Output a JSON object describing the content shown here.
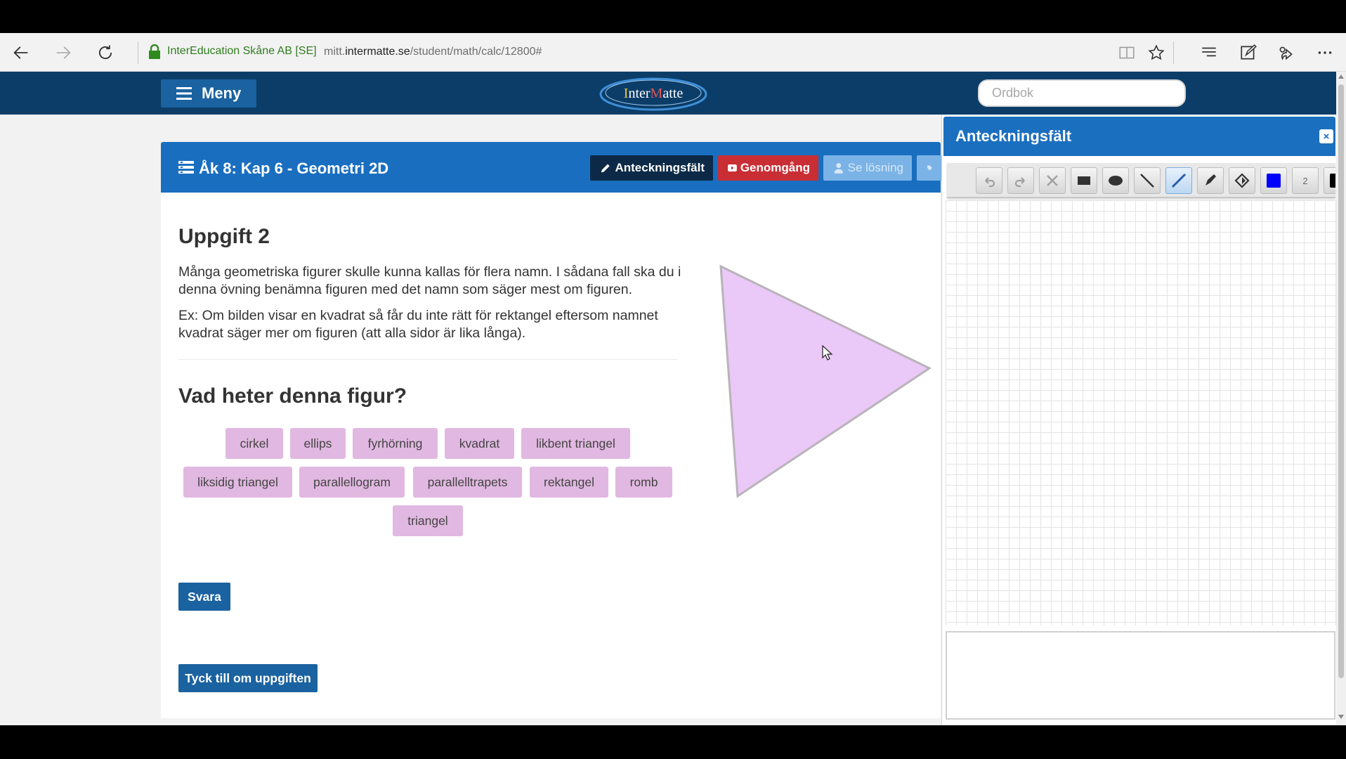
{
  "browser": {
    "site_owner": "InterEducation Skåne AB [SE]",
    "url_prefix": "mitt.",
    "url_domain": "intermatte.se",
    "url_path": "/student/math/calc/12800#",
    "icons": [
      "back-icon",
      "forward-icon",
      "refresh-icon",
      "lock-icon",
      "reading-view-icon",
      "favorite-star-icon",
      "hub-icon",
      "web-note-icon",
      "share-icon",
      "more-icon"
    ]
  },
  "header": {
    "menu_label": "Meny",
    "logo_text_1": "nter",
    "logo_text_i": "I",
    "logo_text_m": "M",
    "logo_text_2": "atte",
    "dictionary_placeholder": "Ordbok"
  },
  "task_bar": {
    "title": "Åk 8: Kap 6 - Geometri 2D",
    "notes_button": "Anteckningsfält",
    "review_button": "Genomgång",
    "solution_button": "Se lösning"
  },
  "task": {
    "heading": "Uppgift 2",
    "paragraph1": "Många geometriska figurer skulle kunna kallas för flera namn. I sådana fall ska du i denna övning benämna figuren med det namn som säger mest om figuren.",
    "paragraph2": "Ex: Om bilden visar en kvadrat så får du inte rätt för rektangel eftersom namnet kvadrat säger mer om figuren (att alla sidor är lika långa).",
    "question": "Vad heter denna figur?",
    "options": [
      "cirkel",
      "ellips",
      "fyrhörning",
      "kvadrat",
      "likbent triangel",
      "liksidig triangel",
      "parallellogram",
      "parallelltrapets",
      "rektangel",
      "romb",
      "triangel"
    ],
    "answer_button": "Svara",
    "feedback_button": "Tyck till om uppgiften",
    "figure": {
      "shape": "triangle",
      "fill": "#eac8f7",
      "stroke": "#b9b3b9"
    }
  },
  "notes_panel": {
    "title": "Anteckningsfält",
    "close_label": "×",
    "pen_size": "2",
    "tools": [
      "undo-icon",
      "redo-icon",
      "clear-icon",
      "rectangle-icon",
      "ellipse-icon",
      "line-icon",
      "pencil-icon",
      "eraser-icon",
      "fill-icon",
      "color-swatch-icon",
      "size-icon",
      "color-swatch-icon"
    ],
    "colors": {
      "selected": "#0000ff",
      "secondary": "#000000"
    }
  },
  "colors": {
    "header_bg": "#0b3d68",
    "task_bar_bg": "#1a6ebf",
    "button_blue": "#1a62a0",
    "chip_bg": "#e1b8e1",
    "review_red": "#c92e35"
  }
}
